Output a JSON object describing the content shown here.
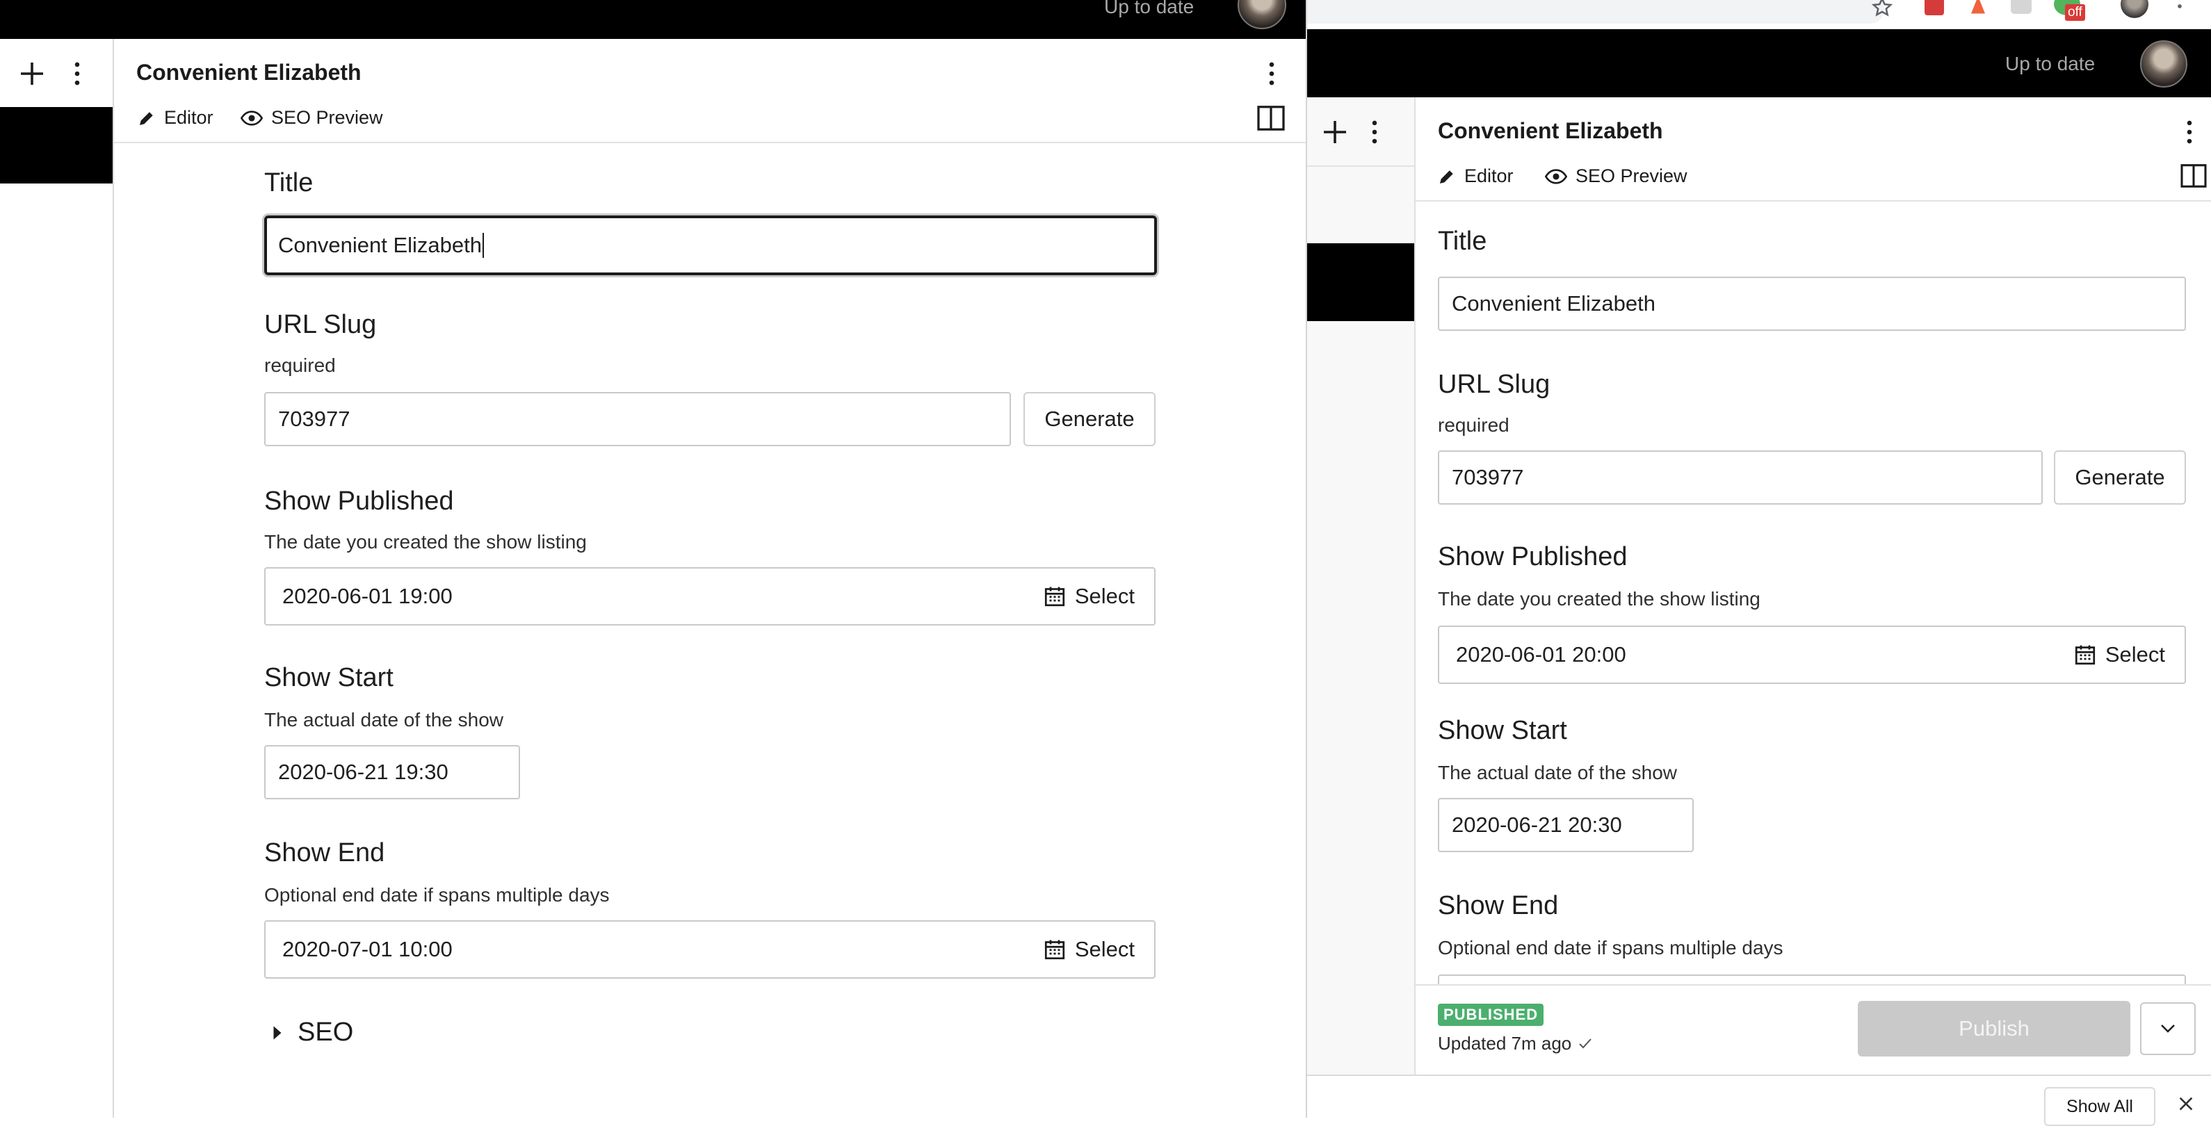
{
  "status": {
    "up_to_date": "Up to date"
  },
  "ext": {
    "off_badge": "off"
  },
  "panel": {
    "doc_title": "Convenient Elizabeth",
    "tabs": [
      {
        "label": "Editor"
      },
      {
        "label": "SEO Preview"
      }
    ]
  },
  "left_form": {
    "title_label": "Title",
    "title_value": "Convenient Elizabeth",
    "slug_label": "URL Slug",
    "slug_help": "required",
    "slug_value": "703977",
    "generate_label": "Generate",
    "published_label": "Show Published",
    "published_help": "The date you created the show listing",
    "published_value": "2020-06-01 19:00",
    "select_label": "Select",
    "start_label": "Show Start",
    "start_help": "The actual date of the show",
    "start_value": "2020-06-21 19:30",
    "end_label": "Show End",
    "end_help": "Optional end date if spans multiple days",
    "end_value": "2020-07-01 10:00",
    "seo_label": "SEO"
  },
  "right_form": {
    "title_label": "Title",
    "title_value": "Convenient Elizabeth",
    "slug_label": "URL Slug",
    "slug_help": "required",
    "slug_value": "703977",
    "generate_label": "Generate",
    "published_label": "Show Published",
    "published_help": "The date you created the show listing",
    "published_value": "2020-06-01 20:00",
    "select_label": "Select",
    "start_label": "Show Start",
    "start_help": "The actual date of the show",
    "start_value": "2020-06-21 20:30",
    "end_label": "Show End",
    "end_help": "Optional end date if spans multiple days"
  },
  "footer": {
    "status_badge": "PUBLISHED",
    "updated": "Updated 7m ago",
    "publish_label": "Publish"
  },
  "bottom_bar": {
    "show_all": "Show All"
  },
  "colors": {
    "topbar": "#000000",
    "published_badge": "#4caf6e",
    "publish_disabled": "#c9c9c9",
    "chrome_bar": "#f1f3f4"
  }
}
